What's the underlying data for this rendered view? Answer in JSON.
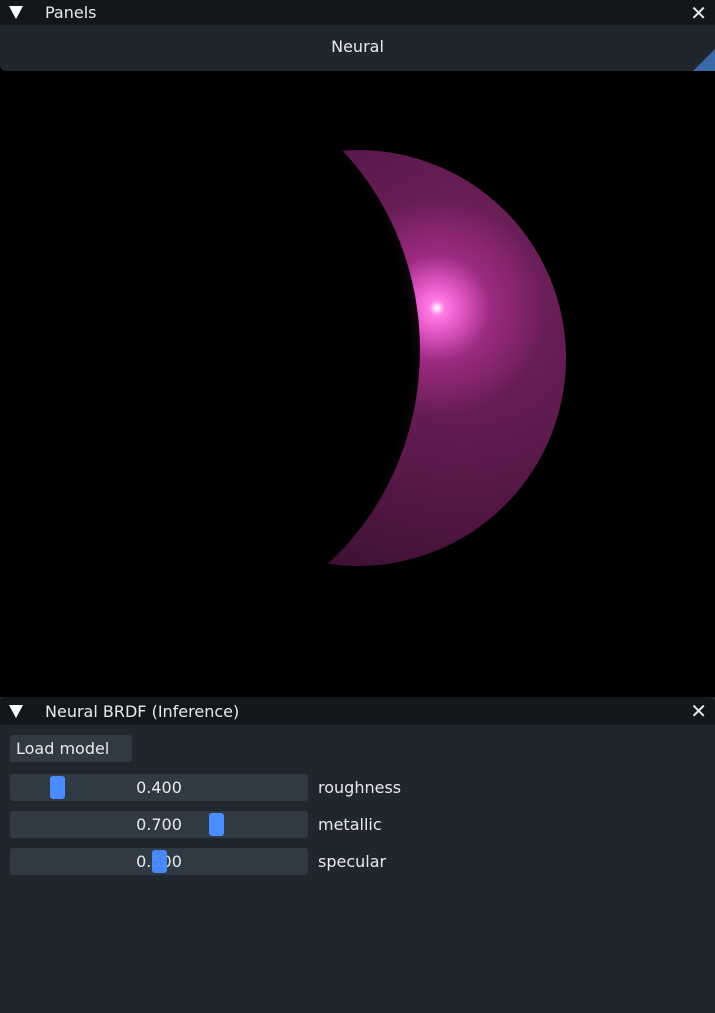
{
  "top_window": {
    "title": "Panels",
    "tab": "Neural"
  },
  "panel": {
    "title": "Neural BRDF (Inference)",
    "load_button": "Load model",
    "sliders": [
      {
        "label": "roughness",
        "value": "0.400",
        "position": 0.14
      },
      {
        "label": "metallic",
        "value": "0.700",
        "position": 0.7
      },
      {
        "label": "specular",
        "value": "0.500",
        "position": 0.5
      }
    ]
  },
  "colors": {
    "accent": "#4a8cff",
    "panel_bg": "#1f262d",
    "title_bg": "#12171b"
  }
}
